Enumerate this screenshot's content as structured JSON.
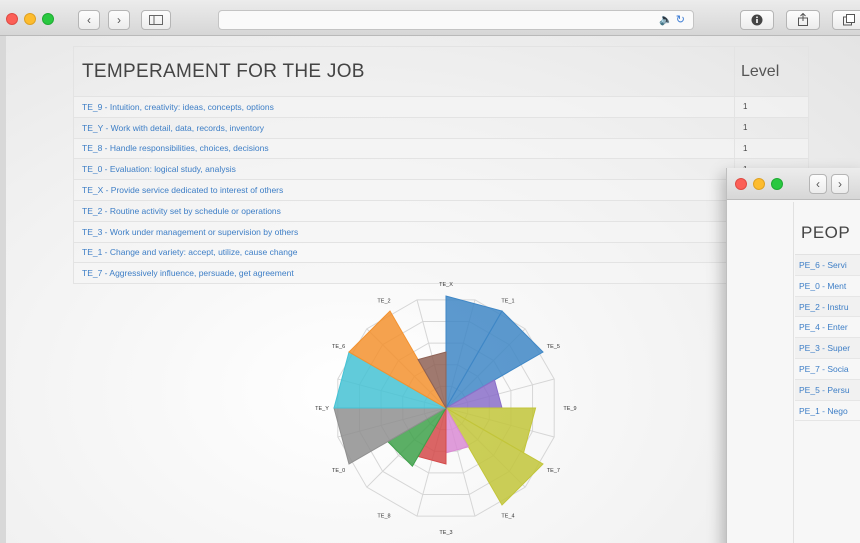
{
  "window": {
    "nav_back": "‹",
    "nav_forward": "›",
    "sidebar_icon": "sidebar-icon",
    "url_icons": "🔈 ↻",
    "toolbar_right": [
      "info-icon",
      "share-icon",
      "tabs-icon"
    ]
  },
  "table": {
    "title": "TEMPERAMENT FOR THE JOB",
    "level_header": "Level",
    "rows": [
      {
        "label": "TE_9 - Intuition, creativity: ideas, concepts, options",
        "level": "1"
      },
      {
        "label": "TE_Y - Work with detail, data, records, inventory",
        "level": "1"
      },
      {
        "label": "TE_8 - Handle responsibilities, choices, decisions",
        "level": "1"
      },
      {
        "label": "TE_0 - Evaluation: logical study, analysis",
        "level": "1"
      },
      {
        "label": "TE_X - Provide service dedicated to interest of others",
        "level": "1"
      },
      {
        "label": "TE_2 - Routine activity set by schedule or operations",
        "level": ""
      },
      {
        "label": "TE_3 - Work under management or supervision by others",
        "level": ""
      },
      {
        "label": "TE_1 - Change and variety: accept, utilize, cause change",
        "level": ""
      },
      {
        "label": "TE_7 - Aggressively influence, persuade, get agreement",
        "level": ""
      }
    ]
  },
  "chart_data": {
    "type": "polar-area",
    "categories": [
      "TE_X",
      "TE_1",
      "TE_5",
      "TE_9",
      "TE_7",
      "TE_4",
      "TE_3",
      "TE_8",
      "TE_0",
      "TE_Y",
      "TE_6",
      "TE_2"
    ],
    "values": [
      5,
      5,
      2.5,
      4,
      5,
      2,
      2.5,
      3,
      5,
      5,
      5,
      2.5
    ],
    "colors": [
      "#3f87c6",
      "#3f87c6",
      "#8a6fc9",
      "#c2c53a",
      "#c2c53a",
      "#d98bd3",
      "#d44a4a",
      "#3ea14a",
      "#8f8f8f",
      "#45c2d4",
      "#f3922f",
      "#8e6256"
    ],
    "rmax": 5,
    "grid": true
  },
  "window2": {
    "nav_back": "‹",
    "nav_forward": "›",
    "title": "PEOP",
    "items": [
      "PE_6 - Servi",
      "PE_0 - Ment",
      "PE_2 - Instru",
      "PE_4 - Enter",
      "PE_3 - Super",
      "PE_7 - Socia",
      "PE_5 - Persu",
      "PE_1 - Nego"
    ]
  }
}
